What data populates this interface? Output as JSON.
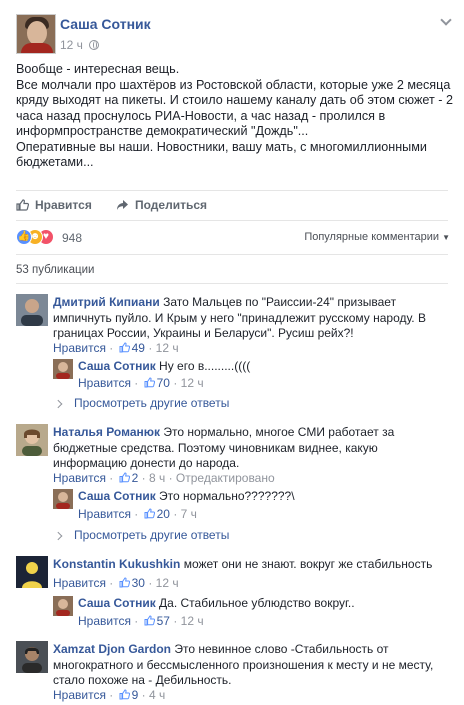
{
  "post": {
    "author": "Саша Сотник",
    "time": "12 ч",
    "paragraphs": [
      "Вообще - интересная вещь.",
      "Все молчали про шахтёров из Ростовской области, которые уже 2 месяца кряду выходят на пикеты. И стоило нашему каналу дать об этом сюжет - 2 часа назад проснулось РИА-Новости, а час назад - пролился в информпространстве демократический \"Дождь\"...",
      "Оперативные вы наши. Новостники, вашу мать, с многомиллионными бюджетами..."
    ],
    "actions": {
      "like": "Нравится",
      "share": "Поделиться"
    },
    "reactions_count": "948",
    "sort_label": "Популярные комментарии",
    "shares_count": "53 публикации"
  },
  "comments": [
    {
      "name": "Дмитрий Кипиани",
      "text": "Зато Мальцев по \"Раиссии-24\" призывает импичнуть пуйло. И Крым у него \"принадлежит русскому народу. В границах России, Украины и Беларуси\". Русиш рейх?!",
      "like_label": "Нравится",
      "likes": "49",
      "time": "12 ч",
      "reply": {
        "name": "Саша Сотник",
        "text": "Ну его в.........((((",
        "like_label": "Нравится",
        "likes": "70",
        "time": "12 ч"
      },
      "more_replies": "Просмотреть другие ответы"
    },
    {
      "name": "Наталья Романюк",
      "text": "Это нормально, многое СМИ работает за бюджетные средства. Поэтому чиновникам виднее, какую информацию донести до народа.",
      "like_label": "Нравится",
      "likes": "2",
      "time": "8 ч",
      "edited": "Отредактировано",
      "reply": {
        "name": "Саша Сотник",
        "text": "Это нормально???????\\",
        "like_label": "Нравится",
        "likes": "20",
        "time": "7 ч"
      },
      "more_replies": "Просмотреть другие ответы"
    },
    {
      "name": "Konstantin Kukushkin",
      "text": "может они не знают. вокруг же стабильность",
      "like_label": "Нравится",
      "likes": "30",
      "time": "12 ч",
      "reply": {
        "name": "Саша Сотник",
        "text": "Да. Стабильное ублюдство вокруг..",
        "like_label": "Нравится",
        "likes": "57",
        "time": "12 ч"
      }
    },
    {
      "name": "Xamzat Djon Gardon",
      "text": "Это невинное слово -Стабильность от многократного и бессмысленного произношения к месту и не месту, стало похоже на - Дебильность.",
      "like_label": "Нравится",
      "likes": "9",
      "time": "4 ч"
    }
  ],
  "colors": {
    "link": "#365899",
    "meta": "#90949c",
    "text": "#1d2129",
    "like_blue": "#5890ff"
  },
  "icons": [
    "globe-icon",
    "chevron-down-icon",
    "like-icon",
    "share-icon",
    "reply-arrow-icon"
  ]
}
